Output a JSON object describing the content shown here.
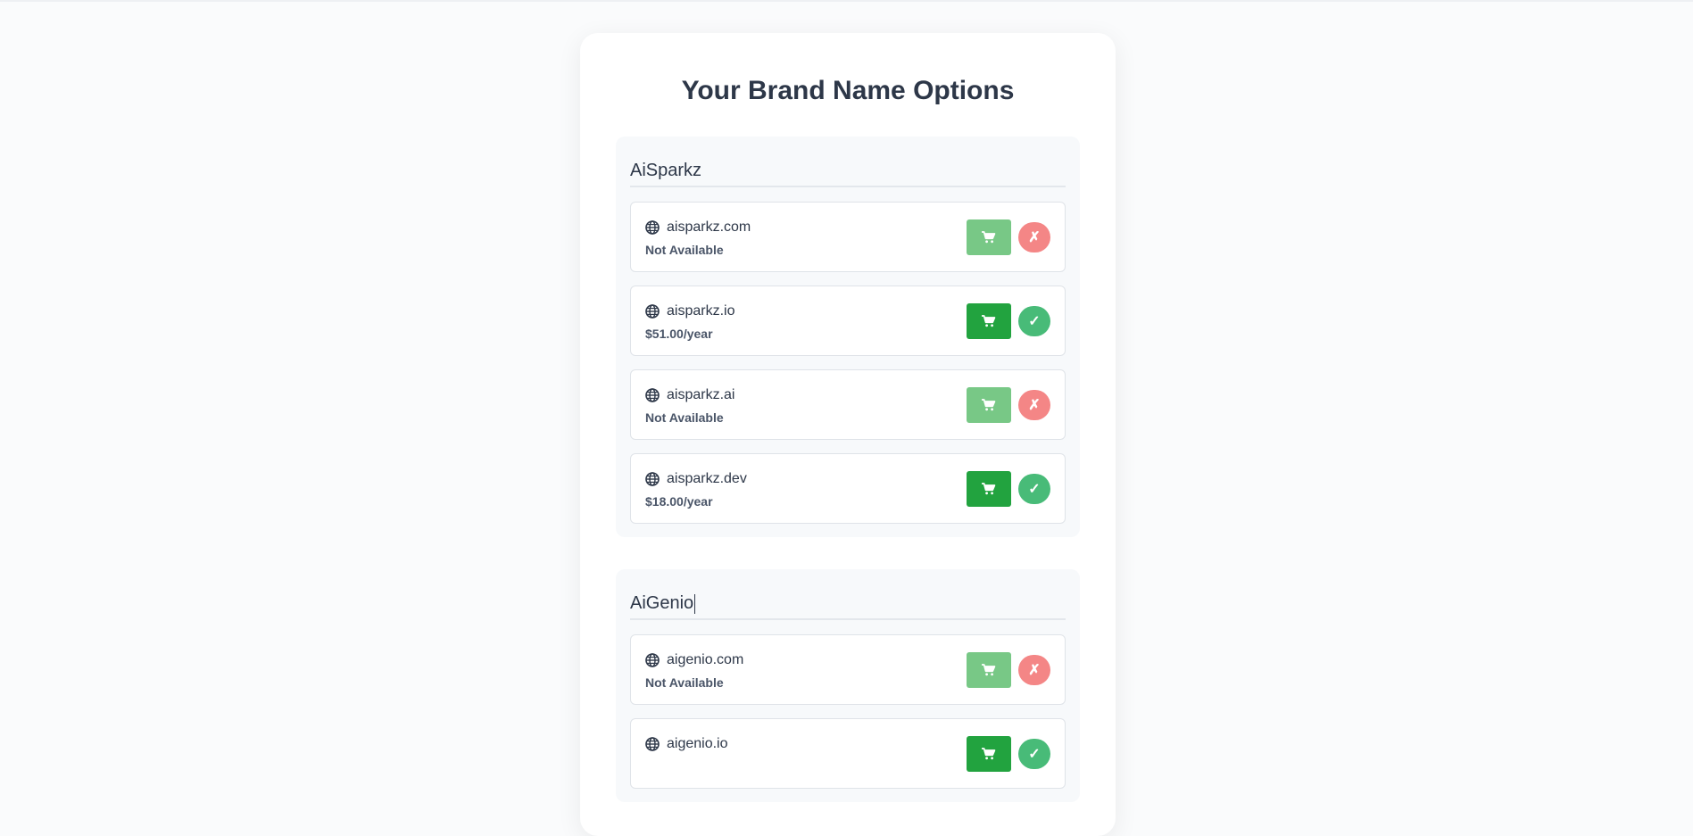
{
  "page": {
    "title": "Your Brand Name Options"
  },
  "groups": [
    {
      "name": "AiSparkz",
      "domains": [
        {
          "name": "aisparkz.com",
          "status": "Not Available",
          "available": false,
          "status_symbol": "✗"
        },
        {
          "name": "aisparkz.io",
          "status": "$51.00/year",
          "available": true,
          "status_symbol": "✓"
        },
        {
          "name": "aisparkz.ai",
          "status": "Not Available",
          "available": false,
          "status_symbol": "✗"
        },
        {
          "name": "aisparkz.dev",
          "status": "$18.00/year",
          "available": true,
          "status_symbol": "✓"
        }
      ]
    },
    {
      "name": "AiGenio",
      "domains": [
        {
          "name": "aigenio.com",
          "status": "Not Available",
          "available": false,
          "status_symbol": "✗"
        },
        {
          "name": "aigenio.io",
          "status": "",
          "available": true,
          "status_symbol": "✓"
        }
      ]
    }
  ],
  "icons": {
    "domain": "globe-icon",
    "cart": "shopping-cart-icon"
  },
  "colors": {
    "title": "#2d3748",
    "cart_available": "#22a33f",
    "cart_unavailable": "#78c886",
    "check": "#48bb78",
    "cross": "#f48686"
  }
}
